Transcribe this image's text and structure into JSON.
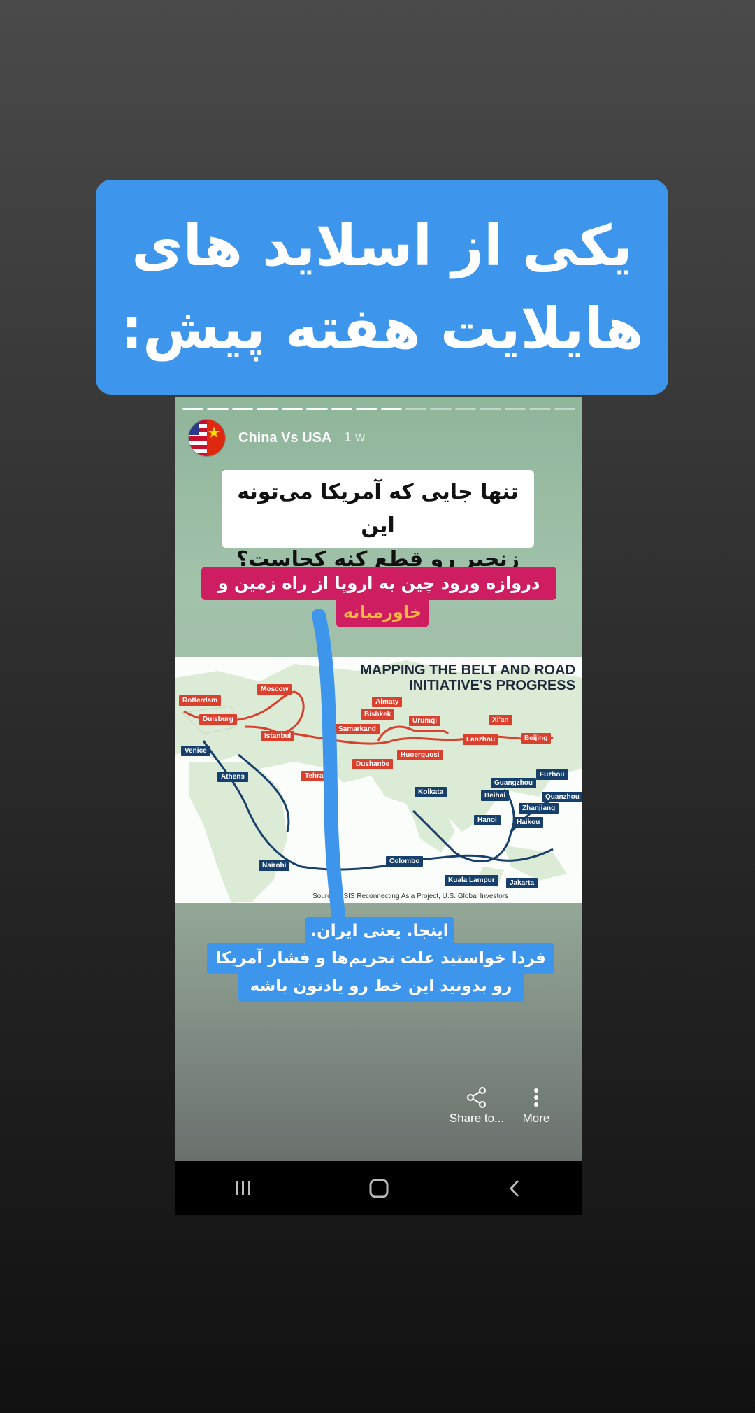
{
  "banner": {
    "line1": "یکی از اسلاید های",
    "line2": "هایلایت هفته پیش:"
  },
  "story": {
    "progress_total": 16,
    "progress_done": 9,
    "account_name": "China Vs USA",
    "time": "1 w",
    "question_line1": "تنها جایی که آمریکا می‌تونه این",
    "question_line2": "زنجیر رو قطع کنه کجاست؟",
    "gate_line1": "دروازه ورود چین به اروپا از راه زمین و دریا",
    "gate_line2": "خاورمیانه",
    "caption_line1": "اینجا. یعنی ایران.",
    "caption_line2": "فردا خواستید علت تحریم‌ها و فشار آمریکا",
    "caption_line3": "رو بدونید این خط رو یادتون باشه"
  },
  "map": {
    "title_line1": "MAPPING THE BELT AND ROAD",
    "title_line2": "INITIATIVE'S PROGRESS",
    "source": "Source: CSIS Reconnecting Asia Project, U.S. Global Investors",
    "cities_red": [
      "Rotterdam",
      "Moscow",
      "Duisburg",
      "Istanbul",
      "Almaty",
      "Bishkek",
      "Samarkand",
      "Urumqi",
      "Xi'an",
      "Lanzhou",
      "Beijing",
      "Huoerguosi",
      "Dushanbe",
      "Tehran"
    ],
    "cities_blue": [
      "Venice",
      "Athens",
      "Kolkata",
      "Guangzhou",
      "Fuzhou",
      "Beihai",
      "Quanzhou",
      "Zhanjiang",
      "Hanoi",
      "Haikou",
      "Colombo",
      "Nairobi",
      "Kuala Lampur",
      "Jakarta"
    ]
  },
  "actions": {
    "share_label": "Share to...",
    "more_label": "More"
  },
  "icons": {
    "share": "share-icon",
    "more": "more-vertical-icon",
    "nav_recents": "recents-icon",
    "nav_home": "home-icon",
    "nav_back": "back-icon"
  },
  "colors": {
    "banner_blue": "#3d95ec",
    "highlight_pink": "#cf1d62",
    "highlight_gold": "#f4b63f",
    "route_red": "#d9402e",
    "route_navy": "#173f6c"
  }
}
